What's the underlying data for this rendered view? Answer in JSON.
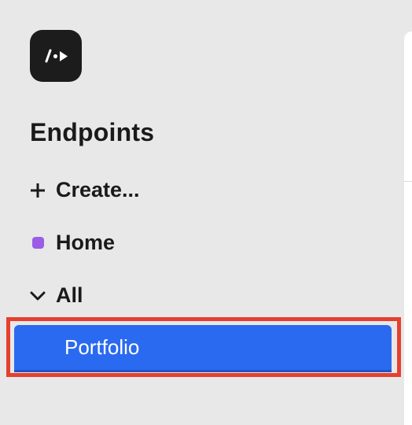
{
  "sidebar": {
    "logo_icon": "endpoint-logo-icon",
    "section_title": "Endpoints",
    "items": [
      {
        "label": "Create...",
        "icon": "plus-icon"
      },
      {
        "label": "Home",
        "icon": "purple-dot-icon",
        "icon_color": "#9b5de5"
      },
      {
        "label": "All",
        "icon": "chevron-down-icon"
      }
    ],
    "selected_item": {
      "label": "Portfolio",
      "background": "#2a6af0"
    }
  },
  "colors": {
    "highlight_border": "#e5402f",
    "sidebar_bg": "#e8e8e8",
    "logo_bg": "#1c1c1c"
  }
}
